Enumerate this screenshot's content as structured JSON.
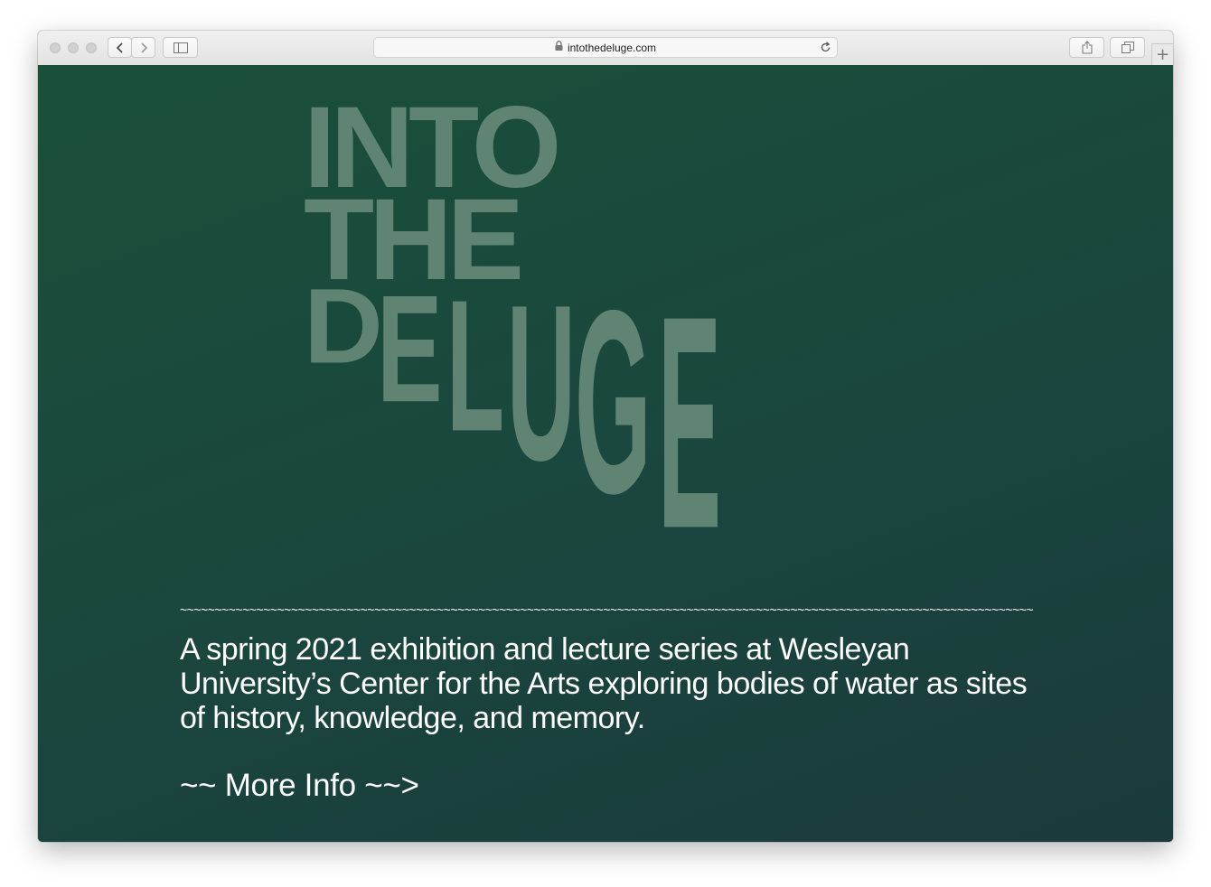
{
  "browser": {
    "url": "intothedeluge.com"
  },
  "logo": {
    "line1": "INTO",
    "line2": "THE",
    "line3_letters": [
      "D",
      "E",
      "L",
      "U",
      "G",
      "E"
    ]
  },
  "main": {
    "divider": "~~~~~~~~~~~~~~~~~~~~~~~~~~~~~~~~~~~~~~~~~~~~~~~~~~~~~~~~~~~~~~~~~~~~~~~~~~~~~~~~~~~~~~~~~~~~~~~~~~~~~~~~~~~~~~~~~~~~~~~~~~~~~~~~~~",
    "description": "A spring 2021 exhibition and lecture series at Wesleyan University’s Center for the Arts exploring bodies of water as sites of history, knowledge, and memory.",
    "more_link": "~~ More Info ~~>"
  },
  "colors": {
    "background_top": "#1a5039",
    "background_bottom": "#1a3a3b",
    "logo_text": "#5f8474",
    "body_text": "#ffffff"
  }
}
